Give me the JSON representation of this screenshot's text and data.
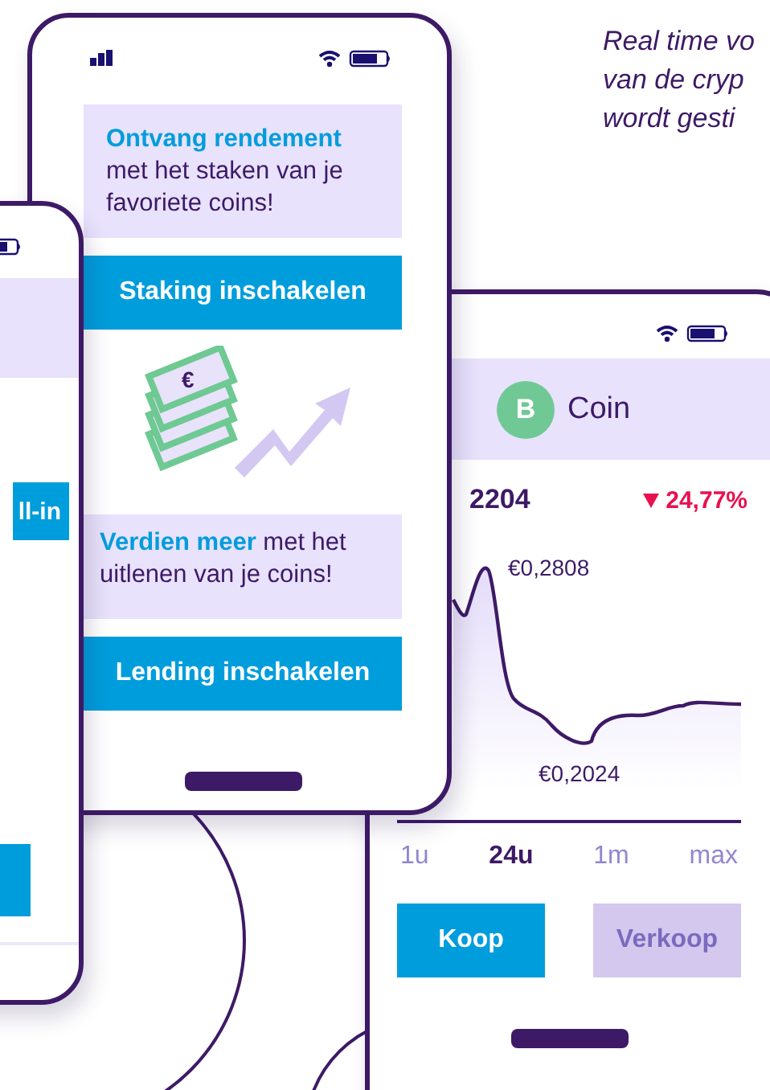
{
  "intro_text": {
    "lines": [
      "Real time vo",
      "van de cryp",
      "wordt gesti"
    ]
  },
  "left_phone": {
    "button": "ll-in"
  },
  "staking_phone": {
    "cards": [
      {
        "text": "**Ontvang rendement** met het staken van je favoriete coins!",
        "button": "Staking inschakelen"
      },
      {
        "text": "**Verdien meer** met het uitlenen van je coins!",
        "button": "Lending inschakelen"
      }
    ],
    "illustration_symbol": "€"
  },
  "coin_phone": {
    "coin_initial": "B",
    "coin_name": "Coin",
    "price": "2204",
    "change": "24,77%",
    "falling": true,
    "high_label": "€0,2808",
    "low_label": "€0,2024",
    "periods": [
      {
        "label": "1u",
        "selected": false
      },
      {
        "label": "24u",
        "selected": true
      },
      {
        "label": "1m",
        "selected": false
      },
      {
        "label": "max",
        "selected": false
      }
    ],
    "buttons": [
      {
        "label": "Koop",
        "disabled": false
      },
      {
        "label": "Verkoop",
        "disabled": true
      }
    ]
  }
}
